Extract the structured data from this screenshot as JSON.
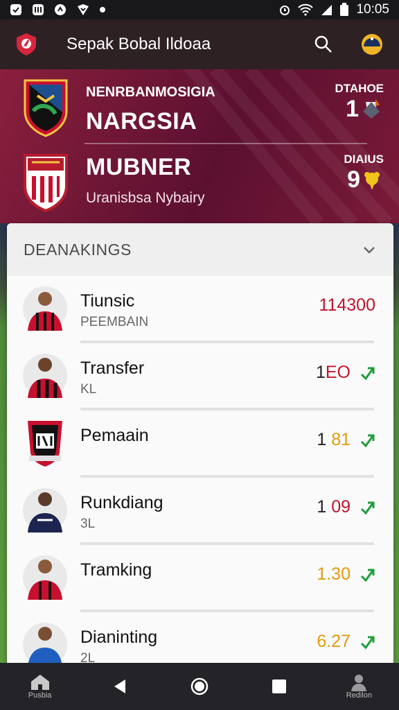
{
  "status_bar": {
    "time": "10:05"
  },
  "app_bar": {
    "title": "Sepak Bobal Ildoaa"
  },
  "hero": {
    "home": {
      "subtitle": "NENRBANMOSIGIA",
      "name": "NARGSIA",
      "stat_label": "DTAHOE",
      "stat_value": "1"
    },
    "away": {
      "name": "MUBNER",
      "caption": "Uranisbsa Nybairy",
      "stat_label": "DIAIUS",
      "stat_value": "9"
    }
  },
  "card": {
    "title": "DEANAKINGS",
    "rows": [
      {
        "title": "Tiunsic",
        "subtitle": "PEEMBAIN",
        "value_black": "",
        "value_color": "114300",
        "color": "#c0142c",
        "trend": false
      },
      {
        "title": "Transfer",
        "subtitle": "KL",
        "value_black": "1",
        "value_color": "EO",
        "color": "#c0142c",
        "trend": true
      },
      {
        "title": "Pemaain",
        "subtitle": "",
        "value_black": "1",
        "value_color": "81",
        "color": "#e39a0c",
        "trend": true
      },
      {
        "title": "Runkdiang",
        "subtitle": "3L",
        "value_black": "1",
        "value_color": "09",
        "color": "#c0142c",
        "trend": true
      },
      {
        "title": "Tramking",
        "subtitle": "",
        "value_black": "",
        "value_color": "1.30",
        "color": "#e39a0c",
        "trend": true
      },
      {
        "title": "Dianinting",
        "subtitle": "2L",
        "value_black": "",
        "value_color": "6.27",
        "color": "#e39a0c",
        "trend": true
      }
    ]
  },
  "nav": {
    "home_label": "Pusbia",
    "profile_label": "Redilon"
  },
  "colors": {
    "brand": "#8a1f3d",
    "up": "#1f9d3a"
  }
}
